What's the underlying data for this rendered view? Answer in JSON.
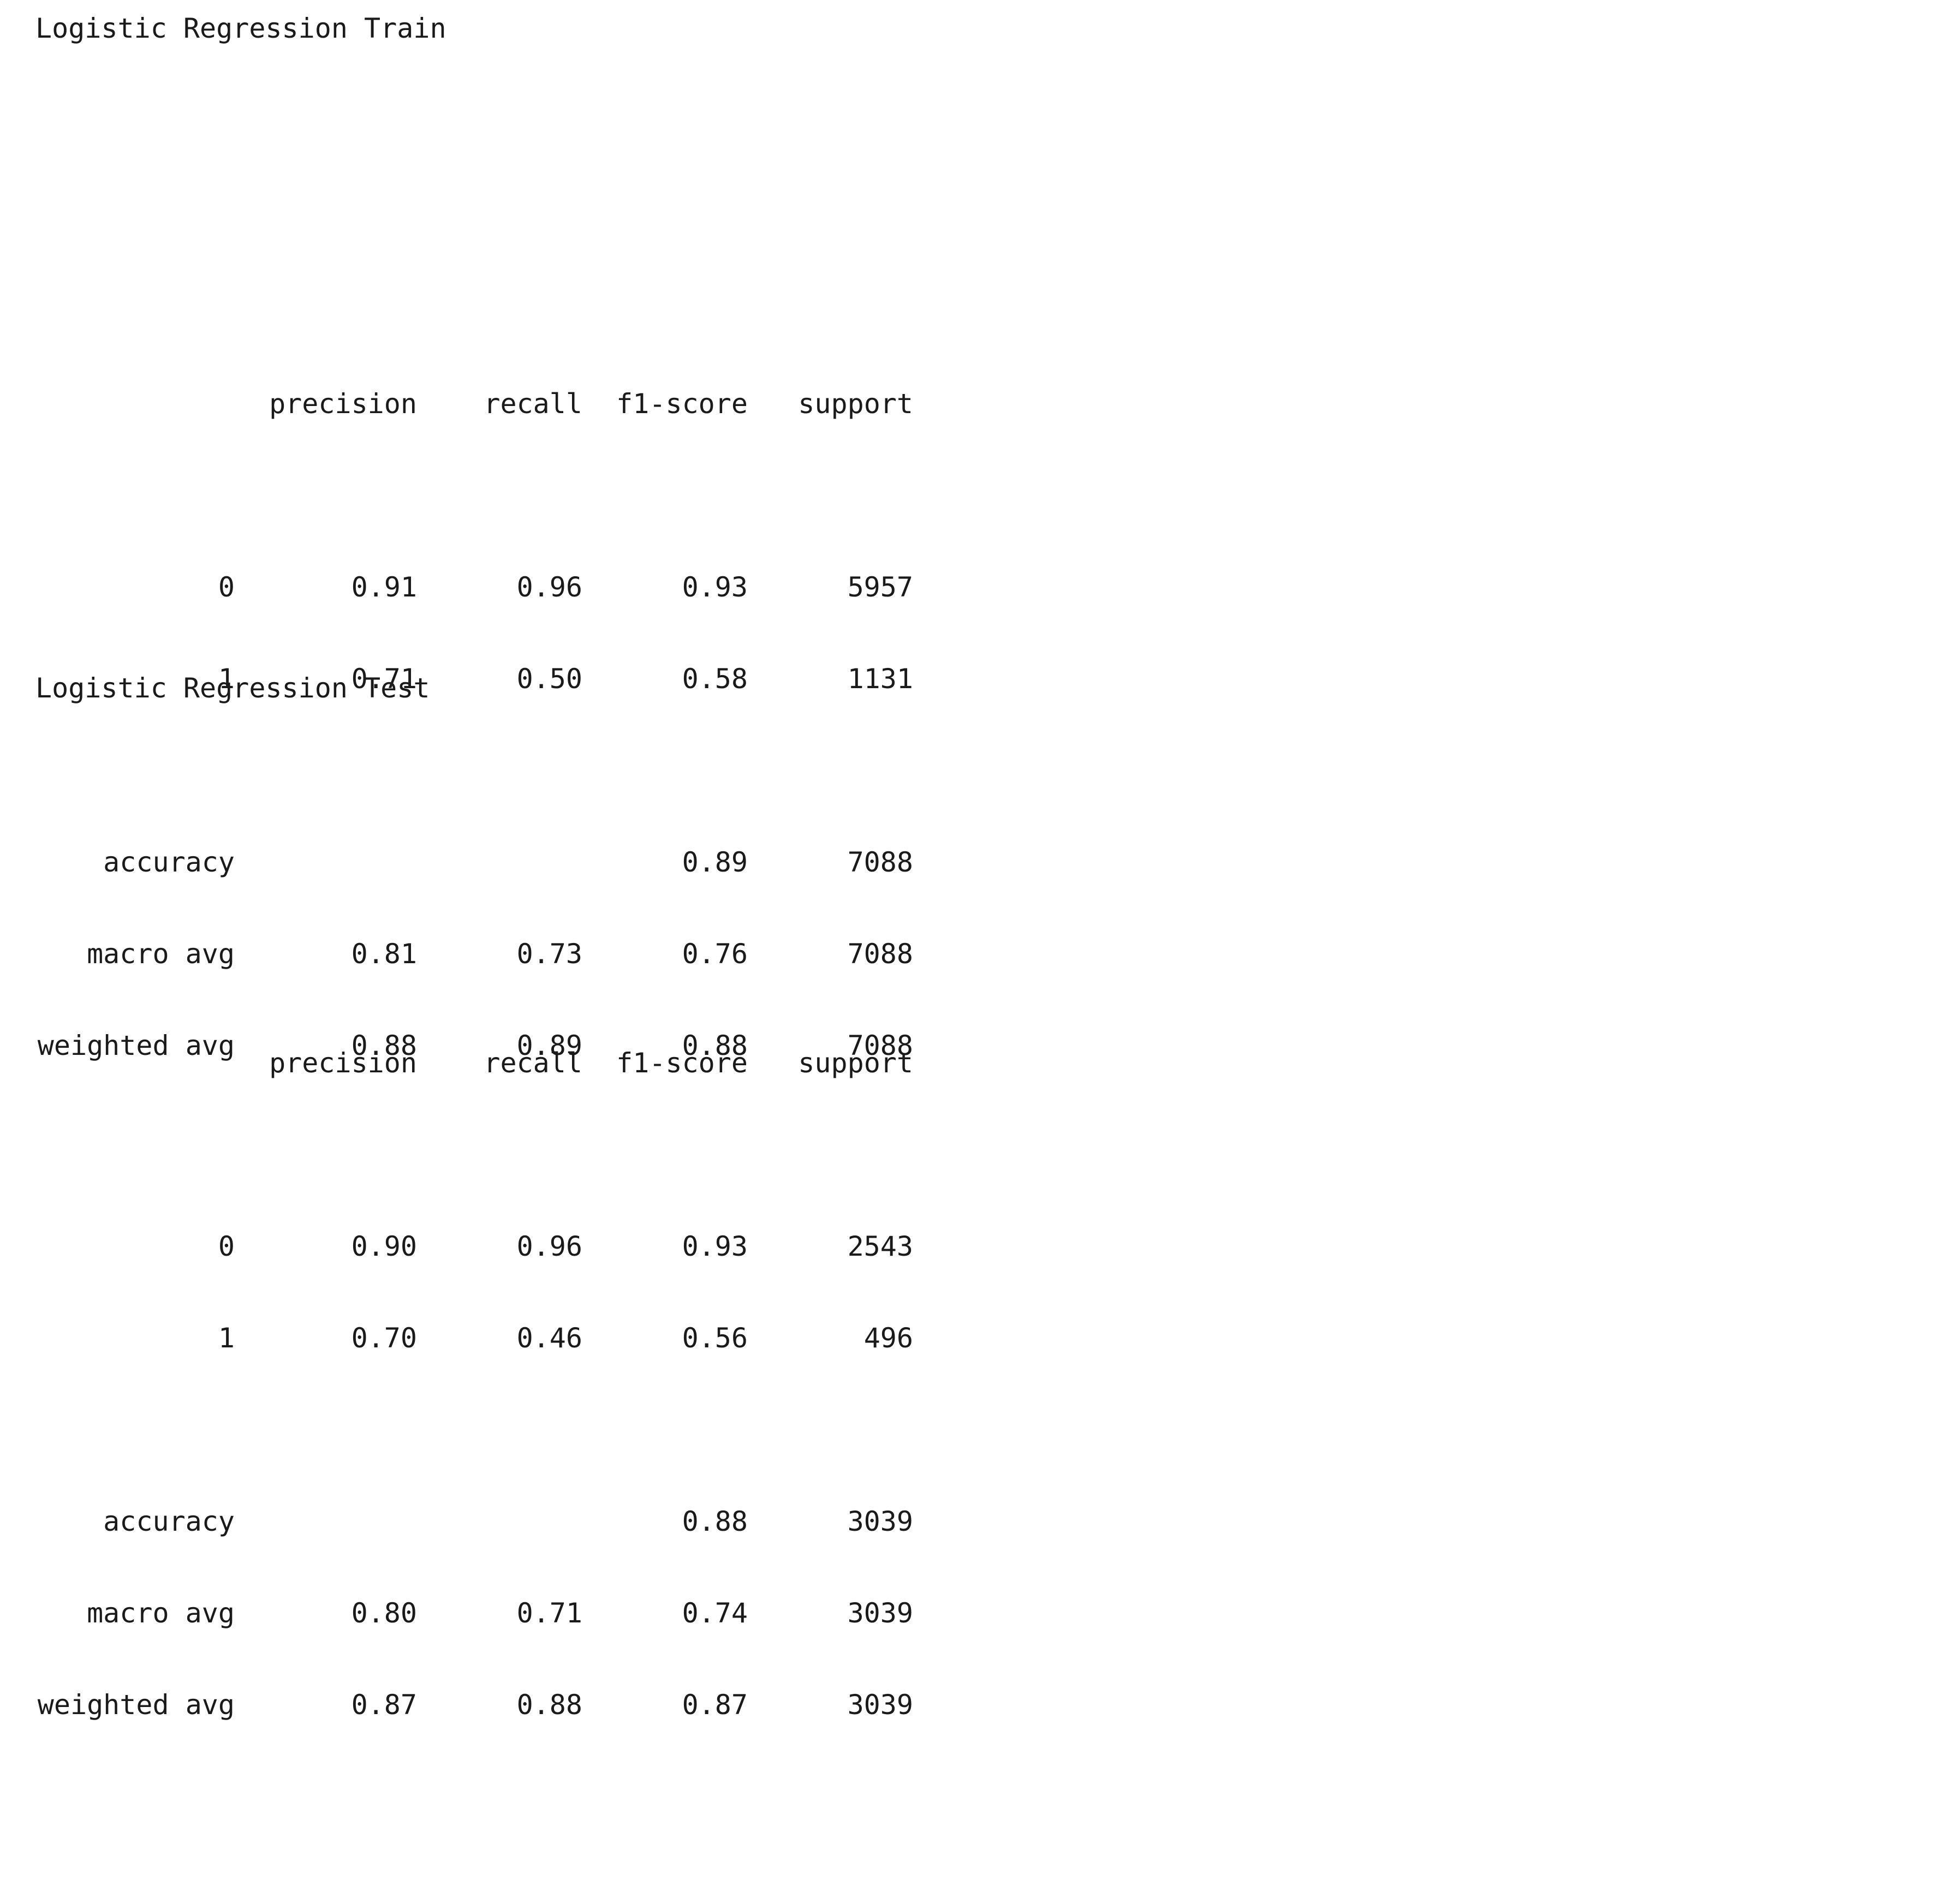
{
  "reports": [
    {
      "title": "Logistic Regression Train",
      "headers": [
        "precision",
        "recall",
        "f1-score",
        "support"
      ],
      "rows": [
        {
          "label": "0",
          "precision": "0.91",
          "recall": "0.96",
          "f1": "0.93",
          "support": "5957"
        },
        {
          "label": "1",
          "precision": "0.71",
          "recall": "0.50",
          "f1": "0.58",
          "support": "1131"
        }
      ],
      "accuracy": {
        "label": "accuracy",
        "f1": "0.89",
        "support": "7088"
      },
      "averages": [
        {
          "label": "macro avg",
          "precision": "0.81",
          "recall": "0.73",
          "f1": "0.76",
          "support": "7088"
        },
        {
          "label": "weighted avg",
          "precision": "0.88",
          "recall": "0.89",
          "f1": "0.88",
          "support": "7088"
        }
      ]
    },
    {
      "title": "Logistic Regression Test",
      "headers": [
        "precision",
        "recall",
        "f1-score",
        "support"
      ],
      "rows": [
        {
          "label": "0",
          "precision": "0.90",
          "recall": "0.96",
          "f1": "0.93",
          "support": "2543"
        },
        {
          "label": "1",
          "precision": "0.70",
          "recall": "0.46",
          "f1": "0.56",
          "support": "496"
        }
      ],
      "accuracy": {
        "label": "accuracy",
        "f1": "0.88",
        "support": "3039"
      },
      "averages": [
        {
          "label": "macro avg",
          "precision": "0.80",
          "recall": "0.71",
          "f1": "0.74",
          "support": "3039"
        },
        {
          "label": "weighted avg",
          "precision": "0.87",
          "recall": "0.88",
          "f1": "0.87",
          "support": "3039"
        }
      ]
    }
  ]
}
